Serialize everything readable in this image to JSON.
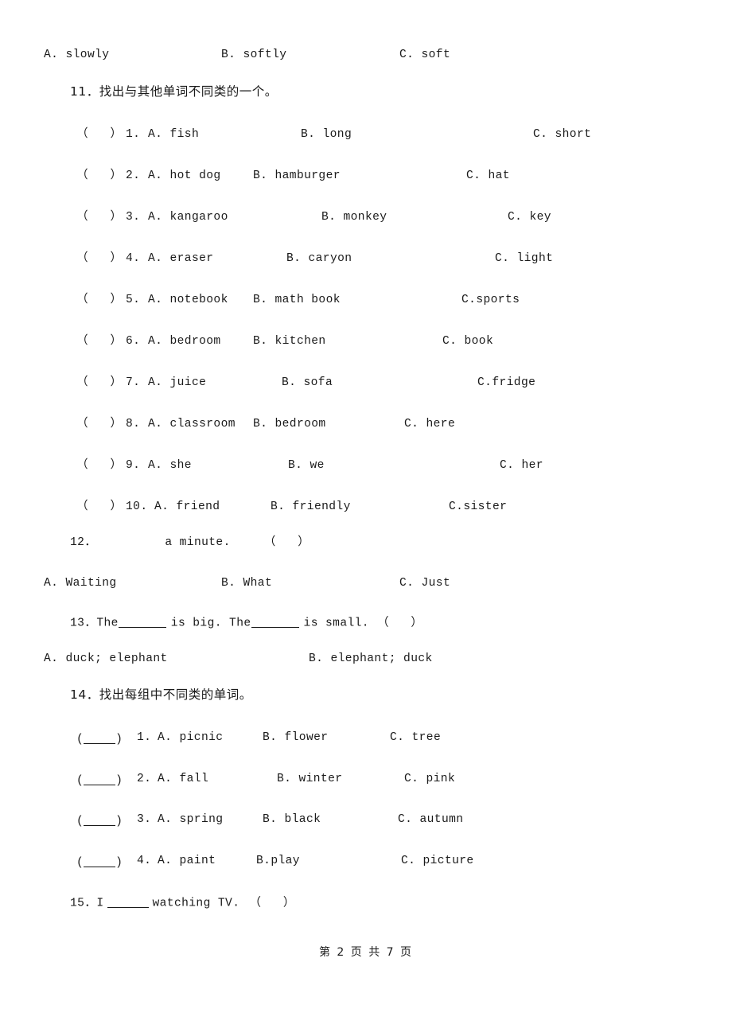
{
  "page": {
    "footer": "第 2 页 共 7 页",
    "page_number": "2",
    "total_pages": "7"
  },
  "q10_options": {
    "a": "A. slowly",
    "b": "B. softly",
    "c": "C. soft"
  },
  "q11": {
    "number": "11．",
    "prompt": "找出与其他单词不同类的一个。",
    "items": [
      {
        "paren": "（   ）",
        "index": "1.",
        "a": "A. fish",
        "b": "B. long",
        "c": "C. short"
      },
      {
        "paren": "（   ）",
        "index": "2.",
        "a": "A. hot dog",
        "b": "B. hamburger",
        "c": "C. hat"
      },
      {
        "paren": "（   ）",
        "index": "3.",
        "a": "A. kangaroo",
        "b": "B. monkey",
        "c": "C. key"
      },
      {
        "paren": "（   ）",
        "index": "4.",
        "a": "A. eraser",
        "b": "B. caryon",
        "c": "C. light"
      },
      {
        "paren": "（   ）",
        "index": "5.",
        "a": "A. notebook",
        "b": "B. math book",
        "c": "C.sports"
      },
      {
        "paren": "（   ）",
        "index": "6.",
        "a": "A. bedroom",
        "b": "B. kitchen",
        "c": "C. book"
      },
      {
        "paren": "（   ）",
        "index": "7.",
        "a": "A. juice",
        "b": "B. sofa",
        "c": "C.fridge"
      },
      {
        "paren": "（   ）",
        "index": "8.",
        "a": "A. classroom",
        "b": "B. bedroom",
        "c": "C. here"
      },
      {
        "paren": "（   ）",
        "index": "9.",
        "a": "A. she",
        "b": "B. we",
        "c": "C. her"
      },
      {
        "paren": "（   ）",
        "index": "10.",
        "a": "A. friend",
        "b": "B. friendly",
        "c": "C.sister"
      }
    ]
  },
  "q12": {
    "number": "12．",
    "text_after_blank": "a minute.",
    "answer_paren": "（   ）",
    "a": "A. Waiting",
    "b": "B. What",
    "c": "C. Just"
  },
  "q13": {
    "number": "13．",
    "part1": "The",
    "part2": "is big. The",
    "part3": "is small.",
    "answer_paren": "（   ）",
    "a": "A. duck; elephant",
    "b": "B. elephant; duck"
  },
  "q14": {
    "number": "14．",
    "prompt": "找出每组中不同类的单词。",
    "items": [
      {
        "index": "1.",
        "a": "A. picnic",
        "b": "B. flower",
        "c": "C. tree"
      },
      {
        "index": "2.",
        "a": "A. fall",
        "b": "B. winter",
        "c": "C. pink"
      },
      {
        "index": "3.",
        "a": "A. spring",
        "b": "B. black",
        "c": "C. autumn"
      },
      {
        "index": "4.",
        "a": "A. paint",
        "b": "B.play",
        "c": "C. picture"
      }
    ]
  },
  "q15": {
    "number": "15．",
    "part1": "I",
    "part2": "watching TV.",
    "answer_paren": "（   ）"
  }
}
